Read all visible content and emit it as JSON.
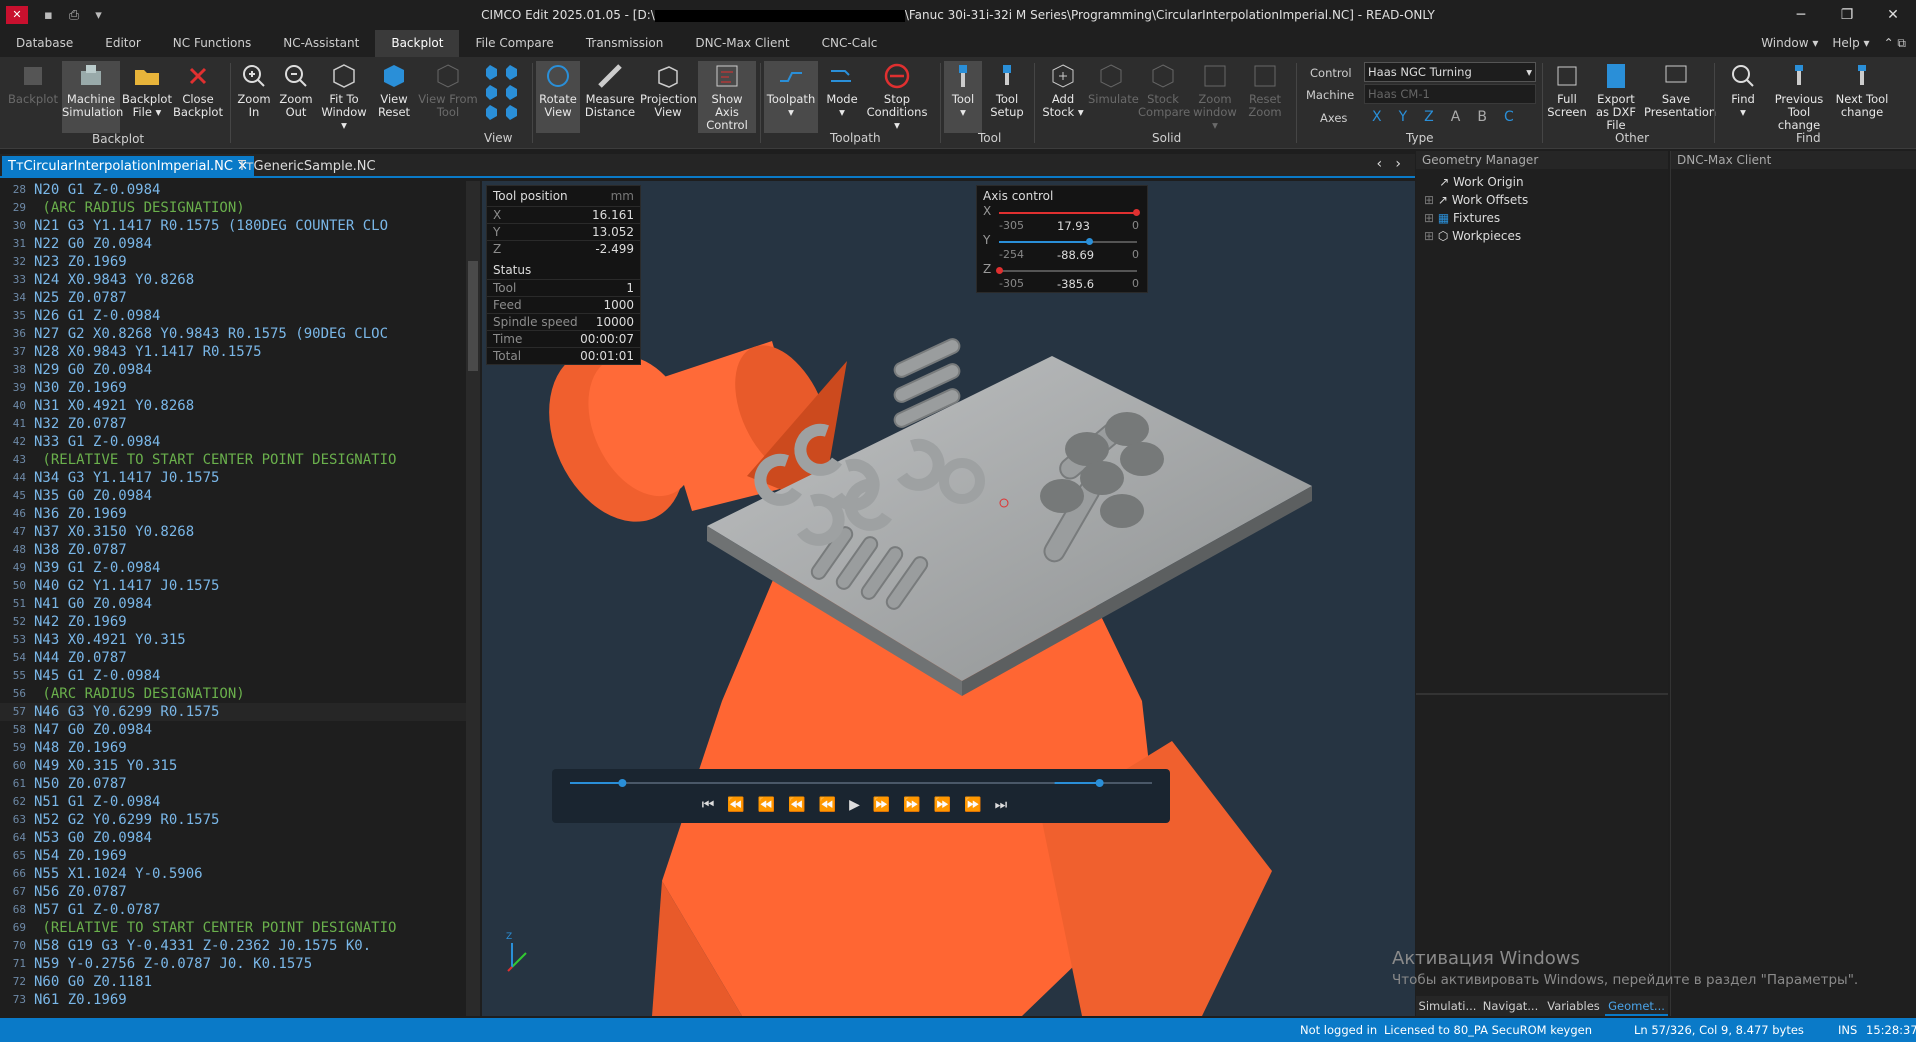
{
  "window": {
    "title_prefix": "CIMCO Edit 2025.01.05 - [D:\\",
    "title_suffix": "\\Fanuc 30i-31i-32i M Series\\Programming\\CircularInterpolationImperial.NC] - READ-ONLY"
  },
  "menu": {
    "tabs": [
      "Database",
      "Editor",
      "NC Functions",
      "NC-Assistant",
      "Backplot",
      "File Compare",
      "Transmission",
      "DNC-Max Client",
      "CNC-Calc"
    ],
    "window": "Window",
    "help": "Help"
  },
  "ribbon": {
    "backplot": "Backplot",
    "machine_sim": "Machine Simulation",
    "backplot_file": "Backplot File",
    "close_backplot": "Close Backplot",
    "group_backplot": "Backplot",
    "zoom_in": "Zoom In",
    "zoom_out": "Zoom Out",
    "fit_window": "Fit To Window",
    "view_reset": "View Reset",
    "view_from_tool": "View From Tool",
    "group_view": "View",
    "rotate_view": "Rotate View",
    "measure_distance": "Measure Distance",
    "projection_view": "Projection View",
    "show_axis_control": "Show Axis Control",
    "toolpath": "Toolpath",
    "mode": "Mode",
    "stop_conditions": "Stop Conditions",
    "group_toolpath": "Toolpath",
    "tool": "Tool",
    "tool_setup": "Tool Setup",
    "group_tool": "Tool",
    "add_stock": "Add Stock",
    "simulate": "Simulate",
    "stock_compare": "Stock Compare",
    "zoom_window": "Zoom window",
    "reset_zoom": "Reset Zoom",
    "group_solid": "Solid",
    "control_label": "Control",
    "control_value": "Haas NGC Turning",
    "machine_label": "Machine",
    "machine_value": "Haas CM-1",
    "axes_label": "Axes",
    "axes": [
      "X",
      "Y",
      "Z",
      "A",
      "B",
      "C"
    ],
    "group_type": "Type",
    "full_screen": "Full Screen",
    "export_dxf": "Export as DXF File",
    "save_presentation": "Save Presentation",
    "group_other": "Other",
    "find": "Find",
    "prev_tool": "Previous Tool change",
    "next_tool": "Next Tool change",
    "group_find": "Find"
  },
  "files": {
    "tab1": "CircularInterpolationImperial.NC",
    "tab2": "GenericSample.NC"
  },
  "code": [
    {
      "n": "28",
      "t": "N20 G1 Z-0.0984",
      "c": false
    },
    {
      "n": "29",
      "t": " (ARC RADIUS DESIGNATION)",
      "c": true
    },
    {
      "n": "30",
      "t": "N21 G3 Y1.1417 R0.1575 (180DEG COUNTER CLO",
      "c": false
    },
    {
      "n": "31",
      "t": "N22 G0 Z0.0984",
      "c": false
    },
    {
      "n": "32",
      "t": "N23 Z0.1969",
      "c": false
    },
    {
      "n": "33",
      "t": "N24 X0.9843 Y0.8268",
      "c": false
    },
    {
      "n": "34",
      "t": "N25 Z0.0787",
      "c": false
    },
    {
      "n": "35",
      "t": "N26 G1 Z-0.0984",
      "c": false
    },
    {
      "n": "36",
      "t": "N27 G2 X0.8268 Y0.9843 R0.1575 (90DEG CLOC",
      "c": false
    },
    {
      "n": "37",
      "t": "N28 X0.9843 Y1.1417 R0.1575",
      "c": false
    },
    {
      "n": "38",
      "t": "N29 G0 Z0.0984",
      "c": false
    },
    {
      "n": "39",
      "t": "N30 Z0.1969",
      "c": false
    },
    {
      "n": "40",
      "t": "N31 X0.4921 Y0.8268",
      "c": false
    },
    {
      "n": "41",
      "t": "N32 Z0.0787",
      "c": false
    },
    {
      "n": "42",
      "t": "N33 G1 Z-0.0984",
      "c": false
    },
    {
      "n": "43",
      "t": " (RELATIVE TO START CENTER POINT DESIGNATIO",
      "c": true
    },
    {
      "n": "44",
      "t": "N34 G3 Y1.1417 J0.1575",
      "c": false
    },
    {
      "n": "45",
      "t": "N35 G0 Z0.0984",
      "c": false
    },
    {
      "n": "46",
      "t": "N36 Z0.1969",
      "c": false
    },
    {
      "n": "47",
      "t": "N37 X0.3150 Y0.8268",
      "c": false
    },
    {
      "n": "48",
      "t": "N38 Z0.0787",
      "c": false
    },
    {
      "n": "49",
      "t": "N39 G1 Z-0.0984",
      "c": false
    },
    {
      "n": "50",
      "t": "N40 G2 Y1.1417 J0.1575",
      "c": false
    },
    {
      "n": "51",
      "t": "N41 G0 Z0.0984",
      "c": false
    },
    {
      "n": "52",
      "t": "N42 Z0.1969",
      "c": false
    },
    {
      "n": "53",
      "t": "N43 X0.4921 Y0.315",
      "c": false
    },
    {
      "n": "54",
      "t": "N44 Z0.0787",
      "c": false
    },
    {
      "n": "55",
      "t": "N45 G1 Z-0.0984",
      "c": false
    },
    {
      "n": "56",
      "t": " (ARC RADIUS DESIGNATION)",
      "c": true
    },
    {
      "n": "57",
      "t": "N46 G3 Y0.6299 R0.1575",
      "c": false
    },
    {
      "n": "58",
      "t": "N47 G0 Z0.0984",
      "c": false
    },
    {
      "n": "59",
      "t": "N48 Z0.1969",
      "c": false
    },
    {
      "n": "60",
      "t": "N49 X0.315 Y0.315",
      "c": false
    },
    {
      "n": "61",
      "t": "N50 Z0.0787",
      "c": false
    },
    {
      "n": "62",
      "t": "N51 G1 Z-0.0984",
      "c": false
    },
    {
      "n": "63",
      "t": "N52 G2 Y0.6299 R0.1575",
      "c": false
    },
    {
      "n": "64",
      "t": "N53 G0 Z0.0984",
      "c": false
    },
    {
      "n": "65",
      "t": "N54 Z0.1969",
      "c": false
    },
    {
      "n": "66",
      "t": "N55 X1.1024 Y-0.5906",
      "c": false
    },
    {
      "n": "67",
      "t": "N56 Z0.0787",
      "c": false
    },
    {
      "n": "68",
      "t": "N57 G1 Z-0.0787",
      "c": false
    },
    {
      "n": "69",
      "t": " (RELATIVE TO START CENTER POINT DESIGNATIO",
      "c": true
    },
    {
      "n": "70",
      "t": "N58 G19 G3 Y-0.4331 Z-0.2362 J0.1575 K0.",
      "c": false
    },
    {
      "n": "71",
      "t": "N59 Y-0.2756 Z-0.0787 J0. K0.1575",
      "c": false
    },
    {
      "n": "72",
      "t": "N60 G0 Z0.1181",
      "c": false
    },
    {
      "n": "73",
      "t": "N61 Z0.1969",
      "c": false
    }
  ],
  "toolpos": {
    "title": "Tool position",
    "unit": "mm",
    "rows": [
      {
        "k": "X",
        "v": "16.161"
      },
      {
        "k": "Y",
        "v": "13.052"
      },
      {
        "k": "Z",
        "v": "-2.499"
      }
    ]
  },
  "status": {
    "title": "Status",
    "rows": [
      {
        "k": "Tool",
        "v": "1"
      },
      {
        "k": "Feed",
        "v": "1000"
      },
      {
        "k": "Spindle speed",
        "v": "10000"
      },
      {
        "k": "Time",
        "v": "00:00:07"
      },
      {
        "k": "Total",
        "v": "00:01:01"
      }
    ]
  },
  "axis": {
    "title": "Axis control",
    "rows": [
      {
        "k": "X",
        "min": "-305",
        "v": "17.93",
        "max": "0",
        "pos": 0.99
      },
      {
        "k": "Y",
        "min": "-254",
        "v": "-88.69",
        "max": "0",
        "pos": 0.65
      },
      {
        "k": "Z",
        "min": "-305",
        "v": "-385.6",
        "max": "0",
        "pos": 0.0
      }
    ]
  },
  "playback": {
    "progress": 0.09,
    "end": 0.91
  },
  "geometry": {
    "title": "Geometry Manager",
    "items": [
      "Work Origin",
      "Work Offsets",
      "Fixtures",
      "Workpieces"
    ]
  },
  "dnc": {
    "title": "DNC-Max Client"
  },
  "bottom_tabs": [
    "Simulati...",
    "Navigat...",
    "Variables",
    "Geomet..."
  ],
  "watermark": {
    "line1": "Активация Windows",
    "line2": "Чтобы активировать Windows, перейдите в раздел \"Параметры\"."
  },
  "statusbar": {
    "login": "Not logged in",
    "license": "Licensed to 80_PA SecuROM keygen",
    "pos": "Ln 57/326, Col 9, 8.477 bytes",
    "mode": "INS",
    "time": "15:28:37"
  }
}
